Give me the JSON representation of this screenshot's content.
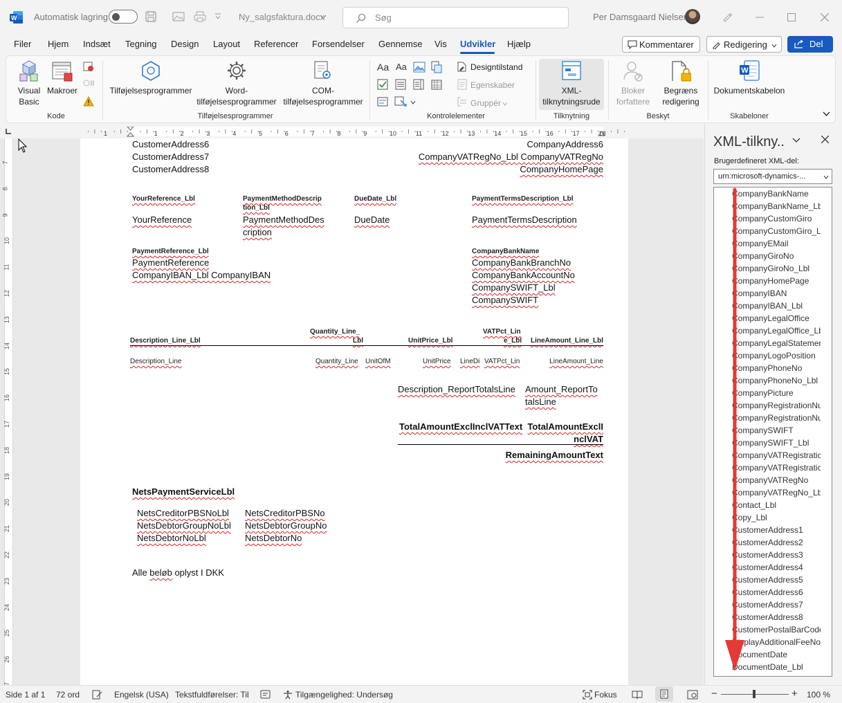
{
  "titlebar": {
    "autosave_label": "Automatisk lagring",
    "filename": "Ny_salgsfaktura.docx",
    "search_placeholder": "Søg",
    "user_name": "Per Damsgaard Nielsen"
  },
  "menu": {
    "tabs": [
      "Filer",
      "Hjem",
      "Indsæt",
      "Tegning",
      "Design",
      "Layout",
      "Referencer",
      "Forsendelser",
      "Gennemse",
      "Vis",
      "Udvikler",
      "Hjælp"
    ],
    "active": "Udvikler",
    "comment_label": "Kommentarer",
    "editing_label": "Redigering",
    "share_label": "Del"
  },
  "ribbon": {
    "visual_basic": [
      "Visual",
      "Basic"
    ],
    "macros": "Makroer",
    "group_code": "Kode",
    "addins": "Tilføjelsesprogrammer",
    "word_addins": [
      "Word-",
      "tilføjelsesprogrammer"
    ],
    "com_addins": [
      "COM-",
      "tilføjelsesprogrammer"
    ],
    "group_addins": "Tilføjelsesprogrammer",
    "design_mode": "Designtilstand",
    "properties": "Egenskaber",
    "groups_btn": "Gruppér",
    "group_controls": "Kontrolelementer",
    "xml_pane": [
      "XML-",
      "tilknytningsrude"
    ],
    "group_mapping": "Tilknytning",
    "block_authors": [
      "Bloker",
      "forfattere"
    ],
    "restrict_editing": [
      "Begræns",
      "redigering"
    ],
    "group_protect": "Beskyt",
    "doc_template": "Dokumentskabelon",
    "group_templates": "Skabeloner"
  },
  "ruler_numbers": [
    "1",
    "1",
    "2",
    "3",
    "4",
    "5",
    "6",
    "7",
    "8",
    "9",
    "10",
    "11",
    "12",
    "13",
    "14",
    "15",
    "16",
    "17",
    "18"
  ],
  "vruler_numbers": [
    "7",
    "8",
    "9",
    "10",
    "11",
    "12",
    "13",
    "14",
    "15",
    "16",
    "17",
    "18",
    "19",
    "20",
    "21",
    "22",
    "23",
    "24",
    "25",
    "26",
    "27"
  ],
  "document": {
    "customer_address6": "CustomerAddress6",
    "customer_address7": "CustomerAddress7",
    "customer_address8": "CustomerAddress8",
    "company_address6": "CompanyAddress6",
    "vat_line": "CompanyVATRegNo_Lbl CompanyVATRegNo",
    "homepage": "CompanyHomePage",
    "your_ref_lbl": "YourReference_Lbl",
    "paymethod_lbl_1": "PaymentMethodDescrip",
    "paymethod_lbl_2": "tion_Lbl",
    "duedate_lbl": "DueDate_Lbl",
    "payterms_lbl": "PaymentTermsDescription_Lbl",
    "your_ref": "YourReference",
    "paymethod_1": "PaymentMethodDes",
    "paymethod_2": "cription",
    "duedate": "DueDate",
    "payterms": "PaymentTermsDescription",
    "payref_lbl": "PaymentReference_Lbl",
    "payref": "PaymentReference",
    "iban_line": "CompanyIBAN_Lbl CompanyIBAN",
    "bankname": "CompanyBankName",
    "bankbranch": "CompanyBankBranchNo",
    "bankaccount": "CompanyBankAccountNo",
    "swift_lbl": "CompanySWIFT_Lbl",
    "swift": "CompanySWIFT",
    "desc_line_lbl": "Description_Line_Lbl",
    "qty_lbl_1": "Quantity_Line_",
    "qty_lbl_2": "Lbl",
    "unitprice_lbl": "UnitPrice_Lbl",
    "vatpct_lbl_1": "VATPct_Lin",
    "vatpct_lbl_2": "e_Lbl",
    "lineamount_lbl": "LineAmount_Line_Lbl",
    "desc_line": "Description_Line",
    "qty_line": "Quantity_Line",
    "unitofm": "UnitOfM",
    "unitprice": "UnitPrice",
    "linedi": "LineDi",
    "vatpct_line": "VATPct_Lin",
    "lineamount": "LineAmount_Line",
    "desc_totals": "Description_ReportTotalsLine",
    "amount_totals_1": "Amount_ReportTo",
    "amount_totals_2": "talsLine",
    "total_text": "TotalAmountExclInclVATText",
    "total_amount_1": "TotalAmountExclI",
    "total_amount_2": "nclVAT",
    "remaining": "RemainingAmountText",
    "nets_lbl": "NetsPaymentServiceLbl",
    "nets_rows": [
      [
        "NetsCreditorPBSNoLbl",
        "NetsCreditorPBSNo"
      ],
      [
        "NetsDebtorGroupNoLbl",
        "NetsDebtorGroupNo"
      ],
      [
        "NetsDebtorNoLbl",
        "NetsDebtorNo"
      ]
    ],
    "footer_pre": "Alle ",
    "footer_word": "beløb",
    "footer_post": " oplyst I DKK"
  },
  "pane": {
    "title": "XML-tilkny..",
    "part_label": "Brugerdefineret XML-del:",
    "part_value": "urn:microsoft-dynamics-...",
    "items": [
      "CompanyBankName",
      "CompanyBankName_Lb",
      "CompanyCustomGiro",
      "CompanyCustomGiro_L",
      "CompanyEMail",
      "CompanyGiroNo",
      "CompanyGiroNo_Lbl",
      "CompanyHomePage",
      "CompanyIBAN",
      "CompanyIBAN_Lbl",
      "CompanyLegalOffice",
      "CompanyLegalOffice_Lb",
      "CompanyLegalStatemer",
      "CompanyLogoPosition",
      "CompanyPhoneNo",
      "CompanyPhoneNo_Lbl",
      "CompanyPicture",
      "CompanyRegistrationNu",
      "CompanyRegistrationNu",
      "CompanySWIFT",
      "CompanySWIFT_Lbl",
      "CompanyVATRegistratic",
      "CompanyVATRegistratic",
      "CompanyVATRegNo",
      "CompanyVATRegNo_Lb",
      "Contact_Lbl",
      "Copy_Lbl",
      "CustomerAddress1",
      "CustomerAddress2",
      "CustomerAddress3",
      "CustomerAddress4",
      "CustomerAddress5",
      "CustomerAddress6",
      "CustomerAddress7",
      "CustomerAddress8",
      "CustomerPostalBarCode",
      "DisplayAdditionalFeeNo",
      "DocumentDate",
      "DocumentDate_Lbl"
    ]
  },
  "status": {
    "page": "Side 1 af 1",
    "words": "72 ord",
    "language": "Engelsk (USA)",
    "predictions": "Tekstfuldførelser: Til",
    "accessibility": "Tilgængelighed: Undersøg",
    "focus": "Fokus",
    "zoom": "100 %"
  },
  "colors": {
    "accent": "#185abd",
    "squiggle": "#e02020",
    "arrow": "#e53935"
  }
}
